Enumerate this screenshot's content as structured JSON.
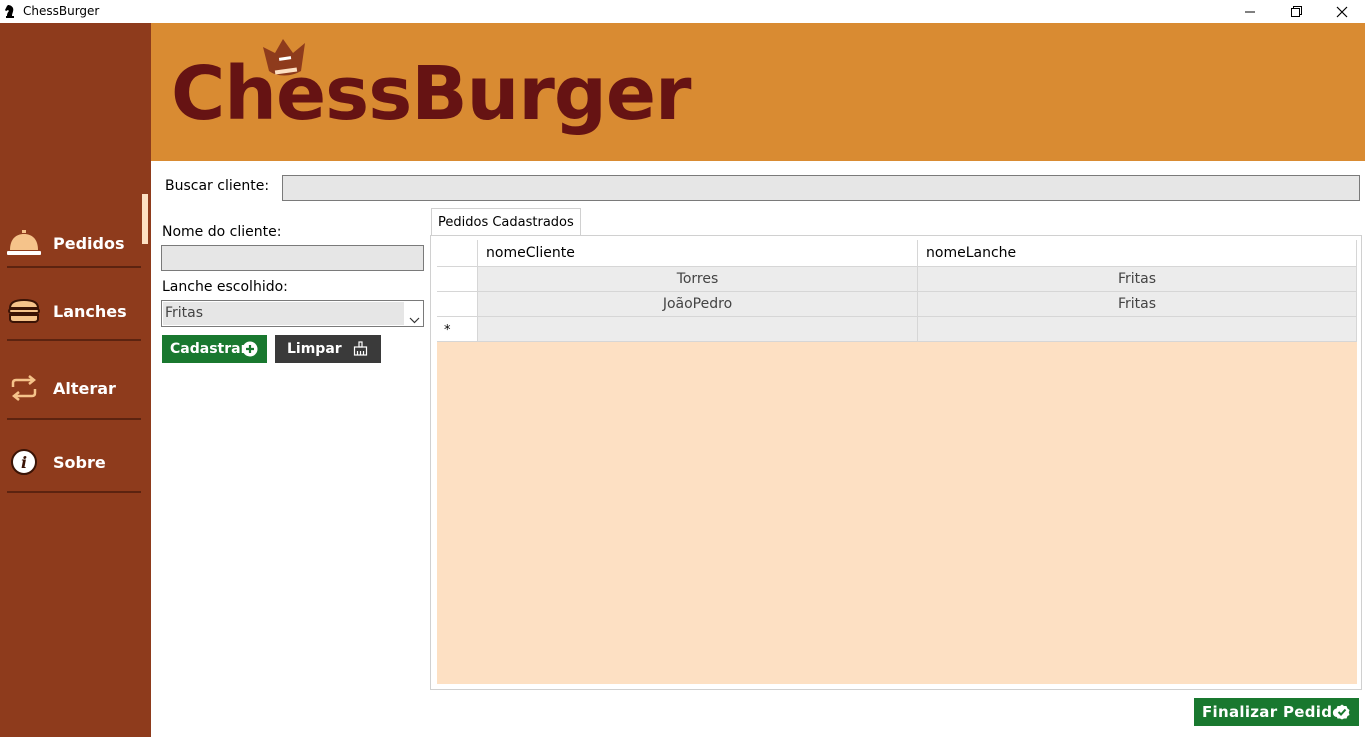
{
  "window": {
    "title": "ChessBurger",
    "icon": "chess-knight-icon"
  },
  "banner": {
    "logo_text": "ChessBurger"
  },
  "sidebar": {
    "items": [
      {
        "label": "Pedidos",
        "icon": "service-bell-icon",
        "active": true
      },
      {
        "label": "Lanches",
        "icon": "burger-icon"
      },
      {
        "label": "Alterar",
        "icon": "swap-arrows-icon"
      },
      {
        "label": "Sobre",
        "icon": "info-icon"
      }
    ]
  },
  "search": {
    "label": "Buscar cliente:",
    "value": ""
  },
  "form": {
    "nome_label": "Nome do cliente:",
    "nome_value": "",
    "lanche_label": "Lanche escolhido:",
    "lanche_value": "Fritas",
    "cadastrar_label": "Cadastrar",
    "limpar_label": "Limpar"
  },
  "tab": {
    "label": "Pedidos Cadastrados"
  },
  "table": {
    "columns": [
      "nomeCliente",
      "nomeLanche"
    ],
    "rows": [
      [
        "Torres",
        "Fritas"
      ],
      [
        "JoãoPedro",
        "Fritas"
      ]
    ],
    "new_row_marker": "*"
  },
  "footer": {
    "finalizar_label": "Finalizar Pedido"
  },
  "colors": {
    "sidebar": "#8e3b1c",
    "banner": "#d98b32",
    "logo": "#661313",
    "grid_background": "#fde0c3",
    "primary_button": "#19782f",
    "secondary_button": "#3a3a3a"
  }
}
